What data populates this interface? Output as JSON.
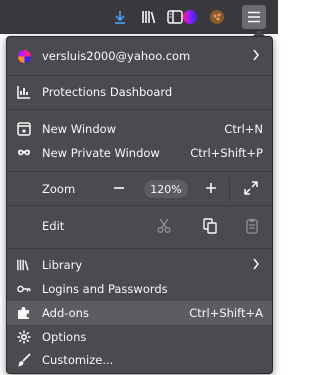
{
  "account": {
    "email": "versluis2000@yahoo.com"
  },
  "menu": {
    "protections": "Protections Dashboard",
    "new_window": "New Window",
    "new_window_shortcut": "Ctrl+N",
    "new_private_window": "New Private Window",
    "new_private_window_shortcut": "Ctrl+Shift+P",
    "zoom_label": "Zoom",
    "zoom_value": "120%",
    "edit_label": "Edit",
    "library": "Library",
    "logins": "Logins and Passwords",
    "addons": "Add-ons",
    "addons_shortcut": "Ctrl+Shift+A",
    "options": "Options",
    "customize": "Customize..."
  },
  "colors": {
    "panel_bg": "#4a4a4f",
    "toolbar_bg": "#38383d",
    "download_accent": "#45a1ff",
    "hover_row": "#5c5c61"
  },
  "icons": [
    "download-icon",
    "library-icon",
    "sidebar-icon",
    "extension-icon",
    "profile-extension-icon",
    "hamburger-menu-icon",
    "account-avatar",
    "chevron-right-icon",
    "protections-icon",
    "new-window-icon",
    "private-window-icon",
    "zoom-out-icon",
    "zoom-in-icon",
    "fullscreen-icon",
    "cut-icon",
    "copy-icon",
    "paste-icon",
    "library-icon",
    "key-icon",
    "puzzle-icon",
    "gear-icon",
    "brush-icon"
  ]
}
